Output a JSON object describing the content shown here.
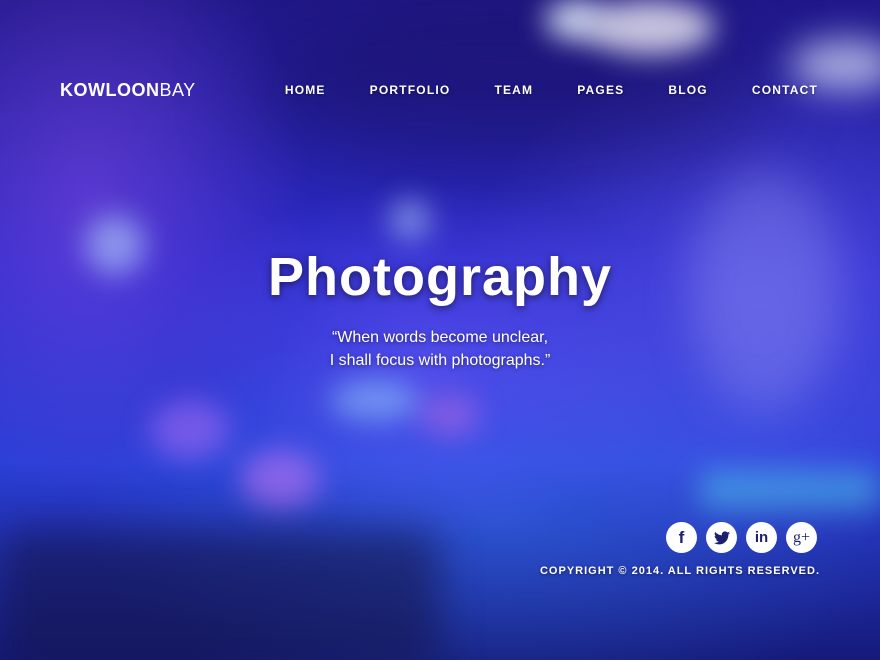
{
  "brand": {
    "logo_bold": "KOWLOON",
    "logo_light": "BAY"
  },
  "nav": [
    {
      "label": "HOME"
    },
    {
      "label": "PORTFOLIO"
    },
    {
      "label": "TEAM"
    },
    {
      "label": "PAGES"
    },
    {
      "label": "BLOG"
    },
    {
      "label": "CONTACT"
    }
  ],
  "hero": {
    "title": "Photography",
    "quote_line1": "“When words become unclear,",
    "quote_line2": "I shall focus with photographs.”"
  },
  "social": [
    {
      "name": "facebook-icon",
      "glyph": "f"
    },
    {
      "name": "twitter-icon"
    },
    {
      "name": "linkedin-icon",
      "glyph": "in"
    },
    {
      "name": "google-plus-icon",
      "glyph": "g+"
    }
  ],
  "footer": {
    "copyright": "COPYRIGHT © 2014. ALL RIGHTS RESERVED."
  },
  "colors": {
    "background": "#2a2fc4",
    "icon_fg": "#1c1f6e",
    "text": "#ffffff"
  }
}
